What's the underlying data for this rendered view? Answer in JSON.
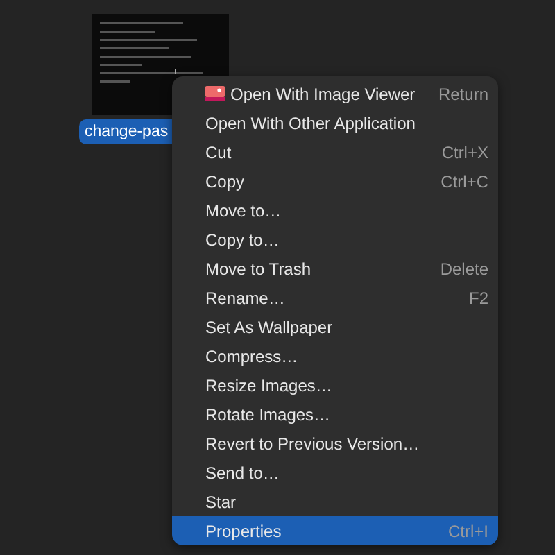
{
  "file": {
    "name": "change-pas",
    "selected": true
  },
  "menu": [
    {
      "label": "Open With Image Viewer",
      "shortcut": "Return",
      "kind": "app",
      "selected": false
    },
    {
      "label": "Open With Other Application",
      "kind": "plain",
      "selected": false
    },
    {
      "label": "Cut",
      "shortcut": "Ctrl+X",
      "kind": "plain",
      "selected": false
    },
    {
      "label": "Copy",
      "shortcut": "Ctrl+C",
      "kind": "plain",
      "selected": false
    },
    {
      "label": "Move to…",
      "kind": "plain",
      "selected": false
    },
    {
      "label": "Copy to…",
      "kind": "plain",
      "selected": false
    },
    {
      "label": "Move to Trash",
      "shortcut": "Delete",
      "kind": "plain",
      "selected": false
    },
    {
      "label": "Rename…",
      "shortcut": "F2",
      "kind": "plain",
      "selected": false
    },
    {
      "label": "Set As Wallpaper",
      "kind": "plain",
      "selected": false
    },
    {
      "label": "Compress…",
      "kind": "plain",
      "selected": false
    },
    {
      "label": "Resize Images…",
      "kind": "plain",
      "selected": false
    },
    {
      "label": "Rotate Images…",
      "kind": "plain",
      "selected": false
    },
    {
      "label": "Revert to Previous Version…",
      "kind": "plain",
      "selected": false
    },
    {
      "label": "Send to…",
      "kind": "plain",
      "selected": false
    },
    {
      "label": "Star",
      "kind": "plain",
      "selected": false
    },
    {
      "label": "Properties",
      "shortcut": "Ctrl+I",
      "kind": "plain",
      "selected": true
    }
  ]
}
